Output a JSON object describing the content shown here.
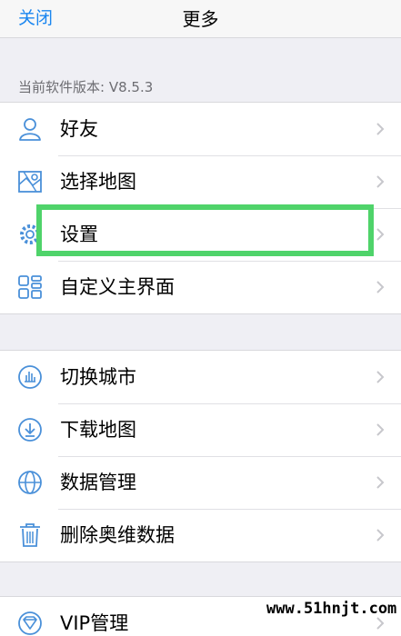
{
  "nav": {
    "close_label": "关闭",
    "title": "更多"
  },
  "version_label": "当前软件版本: V8.5.3",
  "groups": [
    {
      "items": [
        {
          "label": "好友",
          "icon": "person-icon"
        },
        {
          "label": "选择地图",
          "icon": "map-icon"
        },
        {
          "label": "设置",
          "icon": "gear-icon"
        },
        {
          "label": "自定义主界面",
          "icon": "grid-icon"
        }
      ]
    },
    {
      "items": [
        {
          "label": "切换城市",
          "icon": "city-icon"
        },
        {
          "label": "下载地图",
          "icon": "download-icon"
        },
        {
          "label": "数据管理",
          "icon": "globe-icon"
        },
        {
          "label": "删除奥维数据",
          "icon": "trash-icon"
        }
      ]
    },
    {
      "items": [
        {
          "label": "VIP管理",
          "icon": "vip-icon"
        }
      ]
    }
  ],
  "watermark": "www.51hnjt.com",
  "colors": {
    "accent": "#1a86f0",
    "icon": "#4a90d9",
    "highlight": "#4fd36a"
  }
}
